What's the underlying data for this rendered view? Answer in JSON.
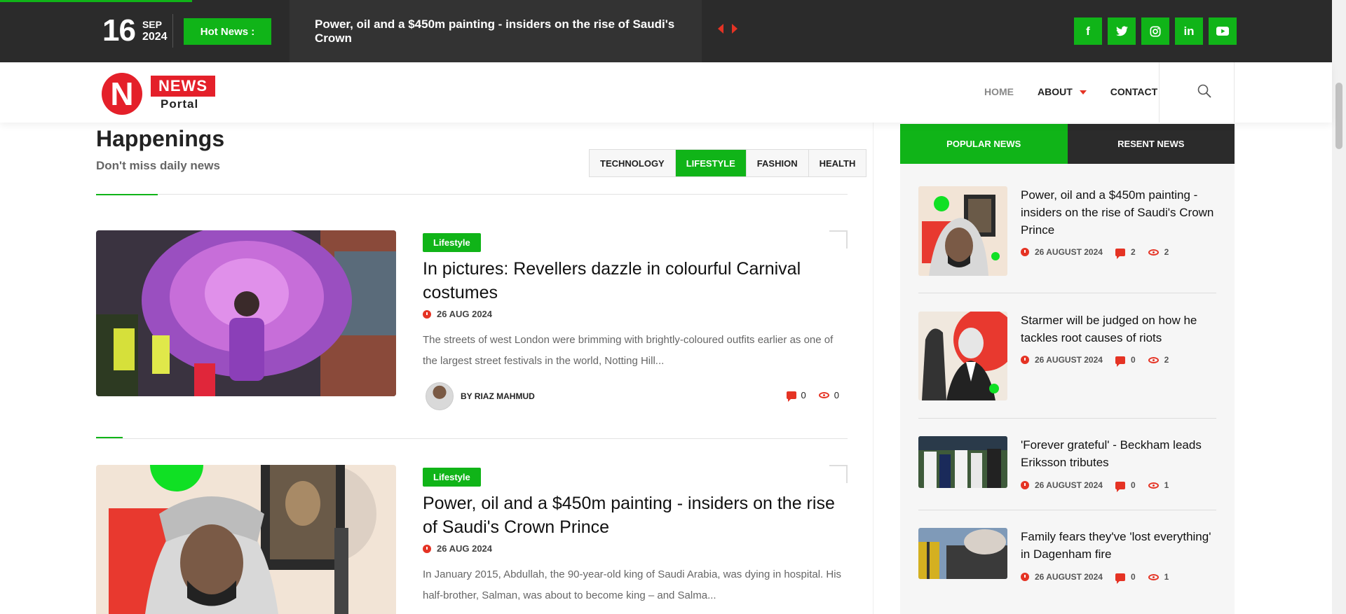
{
  "topbar": {
    "day": "16",
    "month": "SEP",
    "year": "2024",
    "hot_label": "Hot News :",
    "ticker_text": "Power, oil and a $450m painting - insiders on the rise of Saudi's Crown",
    "socials": [
      {
        "icon": "facebook-icon",
        "glyph": "f"
      },
      {
        "icon": "twitter-icon",
        "glyph": "t"
      },
      {
        "icon": "instagram-icon",
        "glyph": "◎"
      },
      {
        "icon": "linkedin-icon",
        "glyph": "in"
      },
      {
        "icon": "youtube-icon",
        "glyph": "▶"
      }
    ]
  },
  "logo": {
    "letter": "N",
    "word1": "NEWS",
    "word2": "Portal"
  },
  "nav": {
    "home": "HOME",
    "about": "ABOUT",
    "contact": "CONTACT"
  },
  "section": {
    "title": "Happenings",
    "subtitle": "Don't miss daily news",
    "tabs": [
      "TECHNOLOGY",
      "LIFESTYLE",
      "FASHION",
      "HEALTH"
    ],
    "active_tab": "LIFESTYLE"
  },
  "articles": [
    {
      "category": "Lifestyle",
      "title": "In pictures: Revellers dazzle in colourful Carnival costumes",
      "date": "26 AUG 2024",
      "excerpt": "The streets of west London were brimming with brightly-coloured outfits earlier as one of the largest street festivals in the world, Notting Hill...",
      "author": "BY RIAZ MAHMUD",
      "comments": "0",
      "views": "0"
    },
    {
      "category": "Lifestyle",
      "title": "Power, oil and a $450m painting - insiders on the rise of Saudi's Crown Prince",
      "date": "26 AUG 2024",
      "excerpt": "In January 2015, Abdullah, the 90-year-old king of Saudi Arabia, was dying in hospital. His half-brother, Salman, was about to become king – and Salma..."
    }
  ],
  "sidebar": {
    "tabs": [
      "POPULAR NEWS",
      "RESENT NEWS"
    ],
    "items": [
      {
        "title": "Power, oil and a $450m painting - insiders on the rise of Saudi's Crown Prince",
        "date": "26 AUGUST 2024",
        "comments": "2",
        "views": "2"
      },
      {
        "title": "Starmer will be judged on how he tackles root causes of riots",
        "date": "26 AUGUST 2024",
        "comments": "0",
        "views": "2"
      },
      {
        "title": "'Forever grateful' - Beckham leads Eriksson tributes",
        "date": "26 AUGUST 2024",
        "comments": "0",
        "views": "1"
      },
      {
        "title": "Family fears they've 'lost everything' in Dagenham fire",
        "date": "26 AUGUST 2024",
        "comments": "0",
        "views": "1"
      }
    ]
  },
  "colors": {
    "accent_green": "#10b418",
    "accent_red": "#e53324",
    "dark": "#2b2b2b"
  }
}
